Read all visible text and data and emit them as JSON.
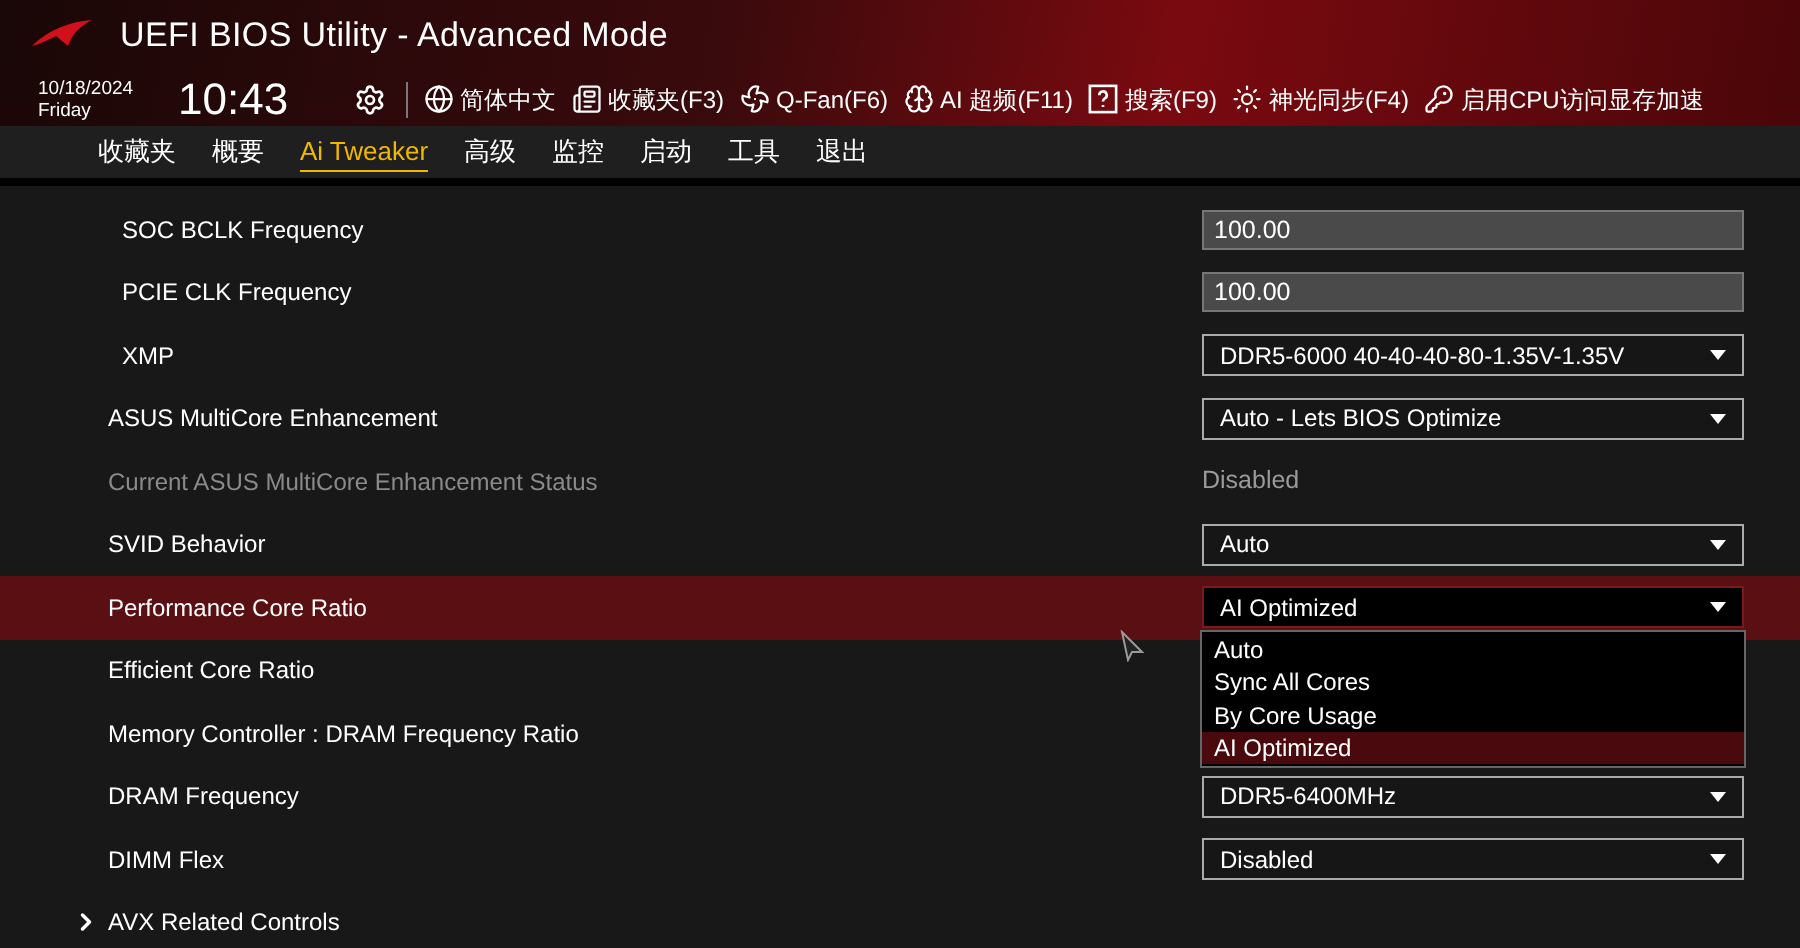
{
  "window": {
    "title": "UEFI BIOS Utility - Advanced Mode"
  },
  "clock": {
    "date": "10/18/2024",
    "day": "Friday",
    "time": "10:43"
  },
  "toolbar": [
    {
      "label": "简体中文"
    },
    {
      "label": "收藏夹(F3)"
    },
    {
      "label": "Q-Fan(F6)"
    },
    {
      "label": "AI 超频(F11)"
    },
    {
      "label": "搜索(F9)"
    },
    {
      "label": "神光同步(F4)"
    },
    {
      "label": "启用CPU访问显存加速"
    }
  ],
  "tabs": [
    {
      "label": "收藏夹",
      "selected": false
    },
    {
      "label": "概要",
      "selected": false
    },
    {
      "label": "Ai Tweaker",
      "selected": true
    },
    {
      "label": "高级",
      "selected": false
    },
    {
      "label": "监控",
      "selected": false
    },
    {
      "label": "启动",
      "selected": false
    },
    {
      "label": "工具",
      "selected": false
    },
    {
      "label": "退出",
      "selected": false
    }
  ],
  "settings": [
    {
      "label": "SOC BCLK Frequency",
      "sub": true,
      "kind": "input",
      "value": "100.00",
      "selected": false,
      "disabled": false
    },
    {
      "label": "PCIE CLK Frequency",
      "sub": true,
      "kind": "input",
      "value": "100.00",
      "selected": false,
      "disabled": false
    },
    {
      "label": "XMP",
      "sub": true,
      "kind": "select",
      "value": "DDR5-6000 40-40-40-80-1.35V-1.35V",
      "selected": false,
      "disabled": false
    },
    {
      "label": "ASUS MultiCore Enhancement",
      "sub": false,
      "kind": "select",
      "value": "Auto - Lets BIOS Optimize",
      "selected": false,
      "disabled": false
    },
    {
      "label": "Current ASUS MultiCore Enhancement Status",
      "sub": false,
      "kind": "readout",
      "value": "Disabled",
      "selected": false,
      "disabled": true
    },
    {
      "label": "SVID Behavior",
      "sub": false,
      "kind": "select",
      "value": "Auto",
      "selected": false,
      "disabled": false
    },
    {
      "label": "Performance Core Ratio",
      "sub": false,
      "kind": "select",
      "value": "AI Optimized",
      "selected": true,
      "disabled": false,
      "options": [
        {
          "label": "Auto",
          "selected": false
        },
        {
          "label": "Sync All Cores",
          "selected": false
        },
        {
          "label": "By Core Usage",
          "selected": false
        },
        {
          "label": "AI Optimized",
          "selected": true
        }
      ]
    },
    {
      "label": "Efficient Core Ratio",
      "sub": false,
      "kind": "hidden",
      "selected": false,
      "disabled": false
    },
    {
      "label": "Memory Controller : DRAM Frequency Ratio",
      "sub": false,
      "kind": "hidden",
      "selected": false,
      "disabled": false
    },
    {
      "label": "DRAM Frequency",
      "sub": false,
      "kind": "select",
      "value": "DDR5-6400MHz",
      "selected": false,
      "disabled": false
    },
    {
      "label": "DIMM Flex",
      "sub": false,
      "kind": "select",
      "value": "Disabled",
      "selected": false,
      "disabled": false
    },
    {
      "label": "AVX Related Controls",
      "sub": false,
      "kind": "submenu",
      "selected": false,
      "disabled": false
    }
  ]
}
